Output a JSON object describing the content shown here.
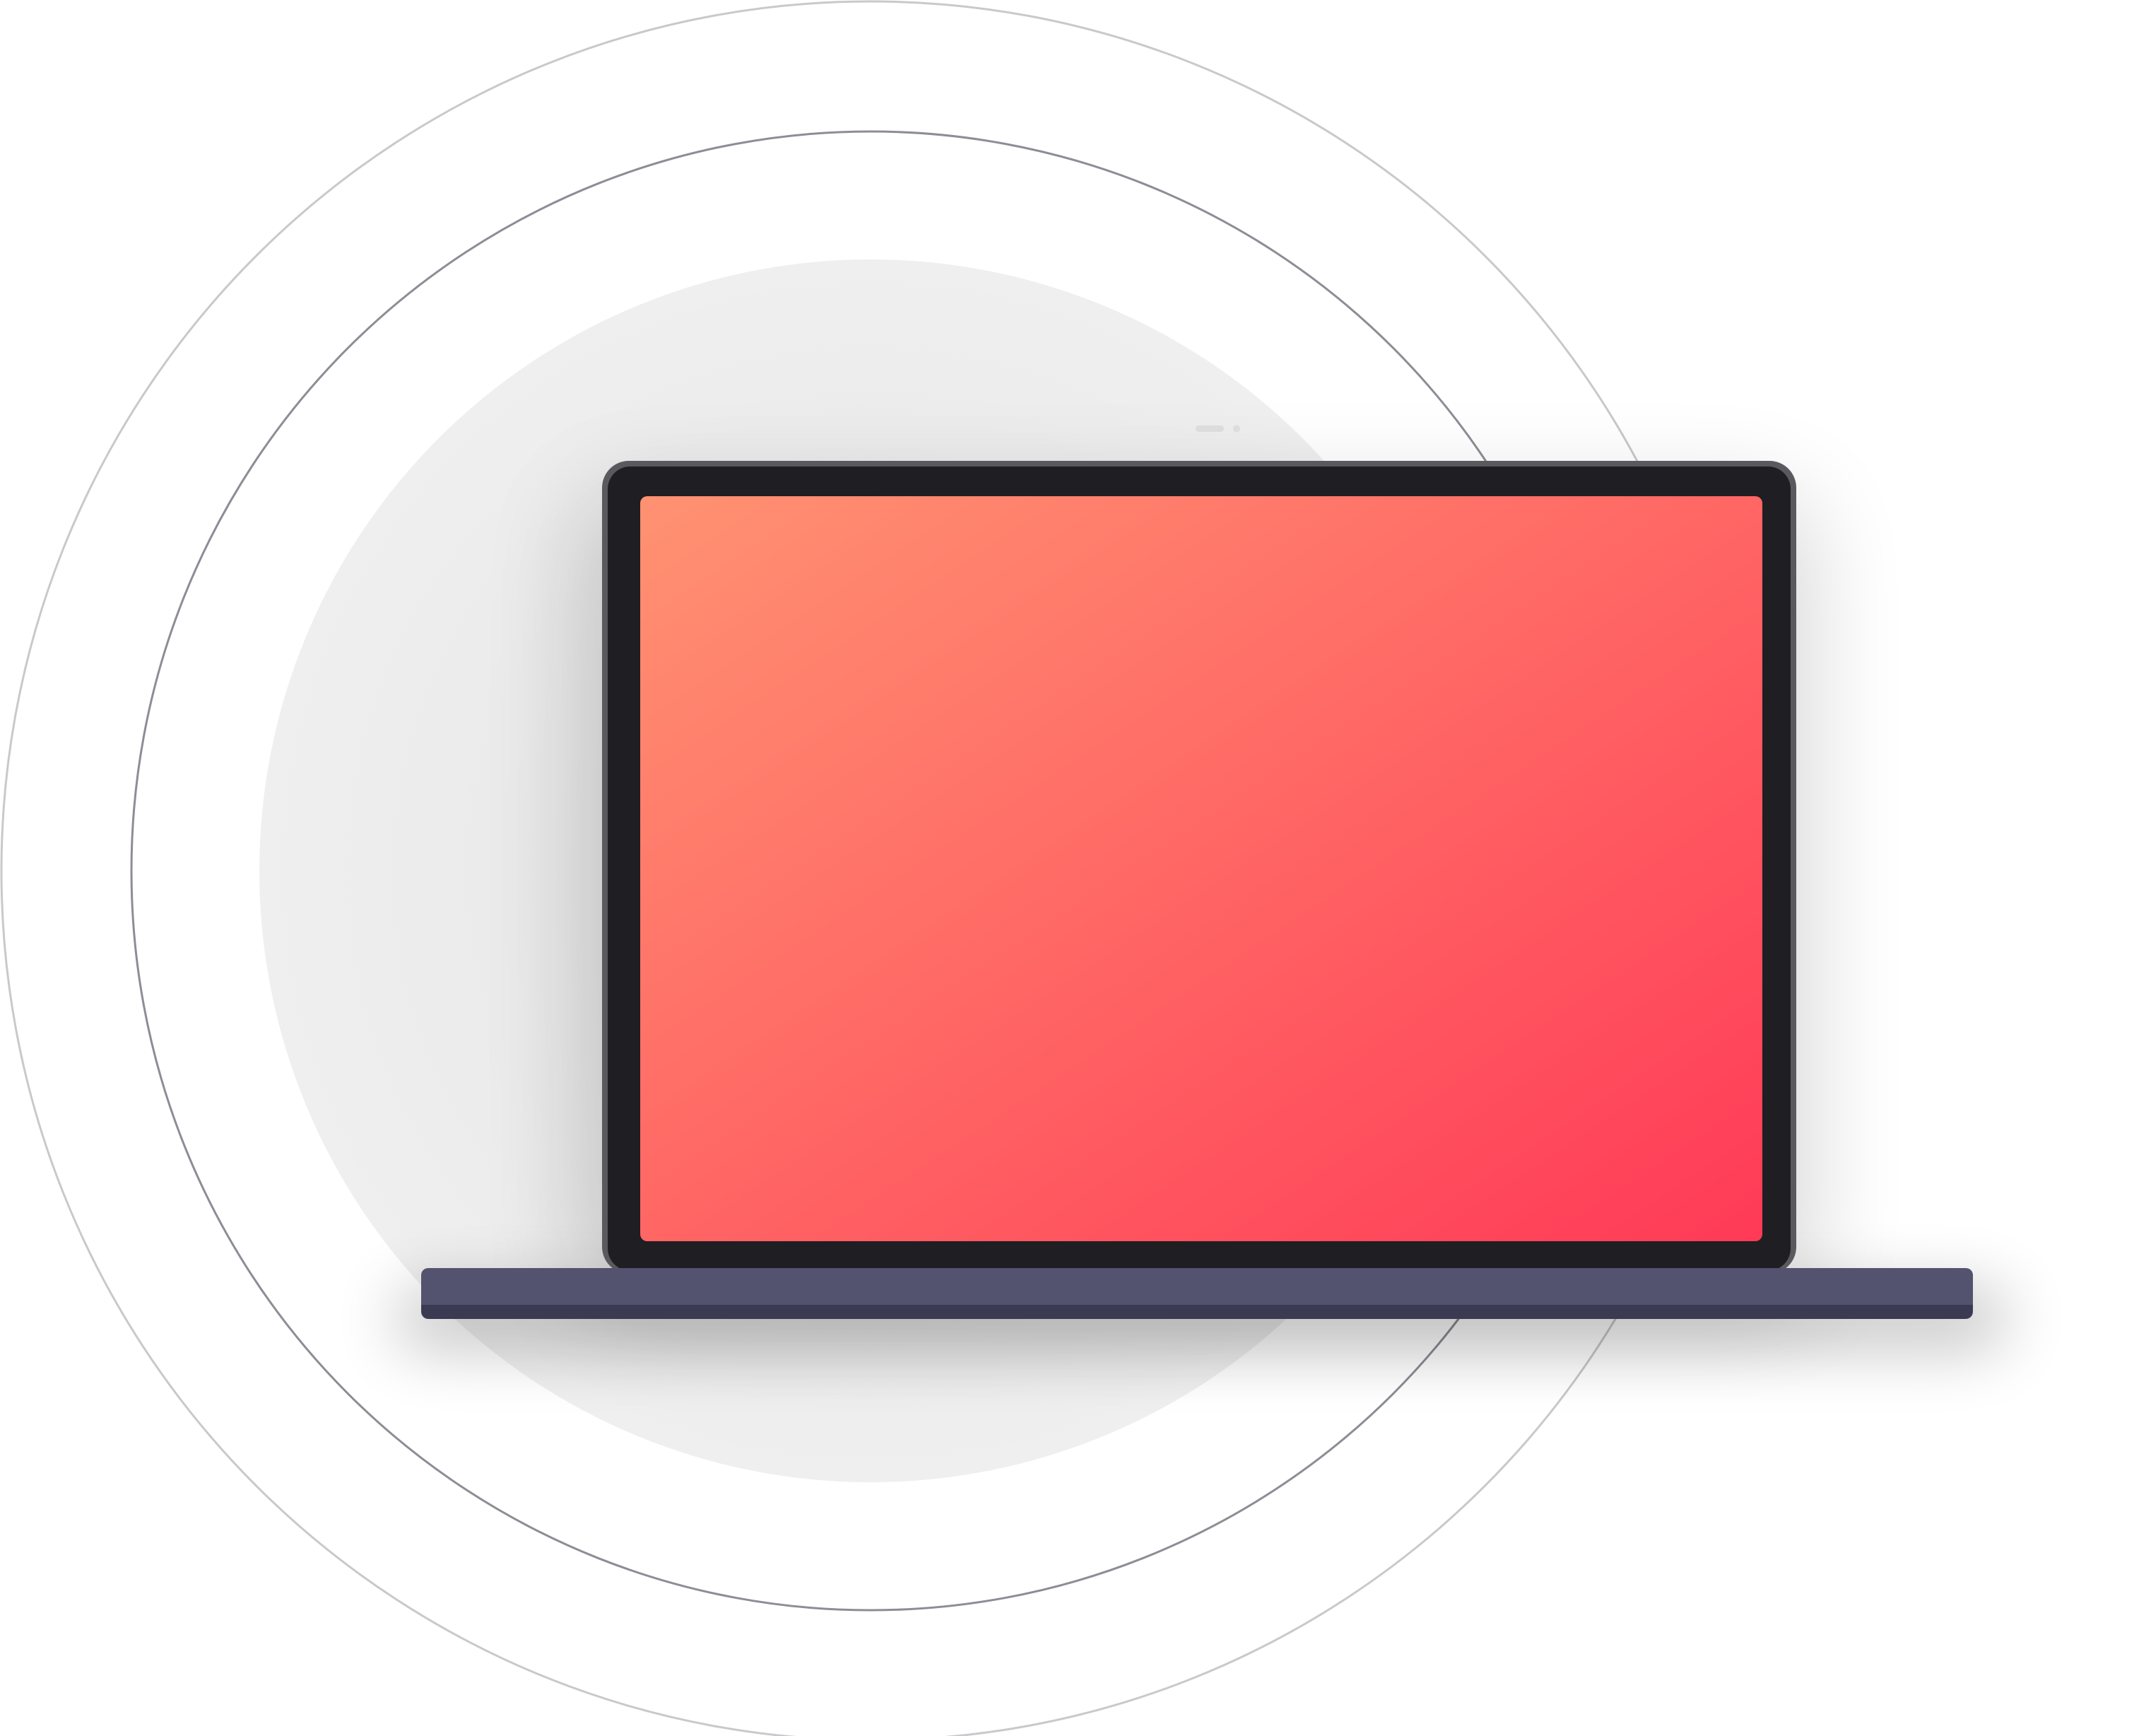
{
  "illustration": {
    "subject": "laptop",
    "icons": {
      "laptop": "laptop-icon",
      "webcam": "webcam-icon"
    },
    "colors": {
      "background": "#ffffff",
      "backdrop_disc": "#ededed",
      "inner_ring": "#8e8c95",
      "outer_ring": "#c9c9cc",
      "bezel": "#1f1e23",
      "bezel_edge": "#5a595e",
      "screen_gradient_start": "#ff9272",
      "screen_gradient_end": "#ff3a57",
      "base_top": "#53526f",
      "base_bottom": "#3b3a53",
      "webcam": "#dcdcdc"
    }
  }
}
